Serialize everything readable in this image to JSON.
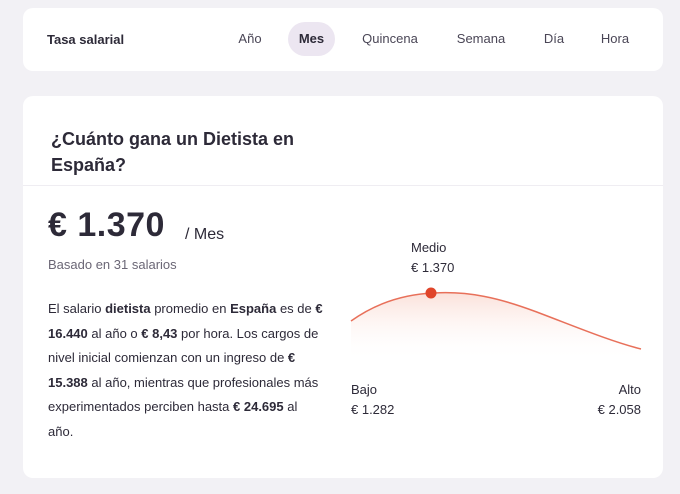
{
  "rate_bar": {
    "title": "Tasa salarial",
    "tabs": [
      {
        "label": "Año",
        "active": false
      },
      {
        "label": "Mes",
        "active": true
      },
      {
        "label": "Quincena",
        "active": false
      },
      {
        "label": "Semana",
        "active": false
      },
      {
        "label": "Día",
        "active": false
      },
      {
        "label": "Hora",
        "active": false
      }
    ]
  },
  "main": {
    "title": "¿Cuánto gana un Dietista en España?",
    "salary": "€ 1.370",
    "period": "/ Mes",
    "basis": "Basado en 31 salarios",
    "description": {
      "t1": "El salario ",
      "job": "dietista",
      "t2": " promedio en ",
      "country": "España",
      "t3": " es de ",
      "annual": "€ 16.440",
      "t4": " al año o ",
      "hourly": "€ 8,43",
      "t5": " por hora. Los cargos de nivel inicial comienzan con un ingreso de ",
      "entry": "€ 15.388",
      "t6": " al año, mientras que profesionales más experimentados perciben hasta ",
      "senior": "€ 24.695",
      "t7": " al año."
    }
  },
  "chart_data": {
    "type": "area",
    "points": [
      {
        "label": "Bajo",
        "value": "€ 1.282"
      },
      {
        "label": "Medio",
        "value": "€ 1.370"
      },
      {
        "label": "Alto",
        "value": "€ 2.058"
      }
    ],
    "colors": {
      "line": "#e8705a",
      "marker": "#e0452a",
      "fill": "#fbe1da"
    }
  }
}
